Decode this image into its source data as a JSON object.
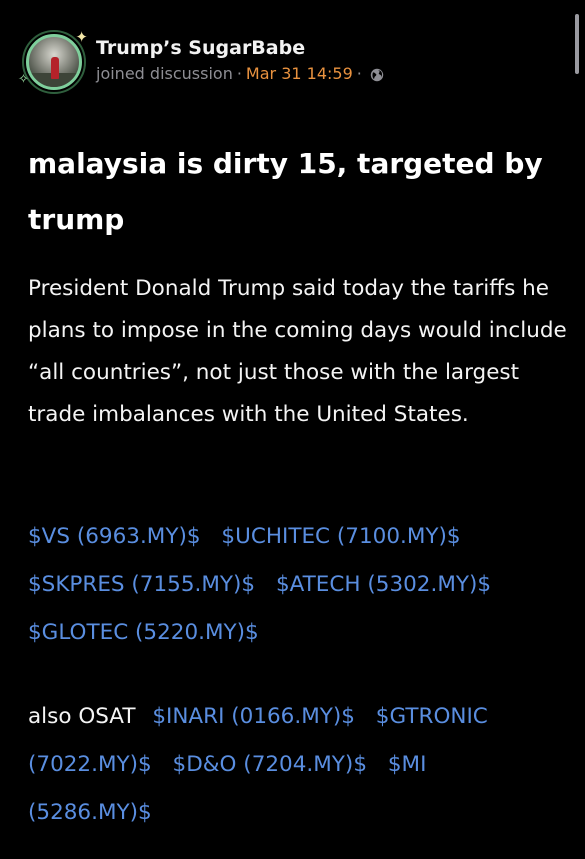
{
  "post": {
    "username": "Trump’s SugarBabe",
    "subline": {
      "joined": "joined discussion",
      "separator": "·",
      "timestamp": "Mar 31 14:59",
      "visibility_icon": "globe-icon"
    },
    "title": "malaysia is dirty 15, targeted by trump",
    "body": "President Donald Trump said today the tariffs he plans to impose in the coming days would include “all countries”, not just those with the largest trade imbalances with the United States.",
    "tickers_group1": [
      "$VS (6963.MY)$",
      "$UCHITEC (7100.MY)$",
      "$SKPRES (7155.MY)$",
      "$ATECH (5302.MY)$",
      "$GLOTEC (5220.MY)$"
    ],
    "osat_label": "also OSAT",
    "tickers_group2": [
      "$INARI (0166.MY)$",
      "$GTRONIC (7022.MY)$",
      "$D&O (7204.MY)$",
      "$MI (5286.MY)$"
    ]
  },
  "colors": {
    "background": "#000000",
    "link": "#5a8ee0",
    "timestamp": "#e9923f",
    "muted": "#8e8e94"
  }
}
